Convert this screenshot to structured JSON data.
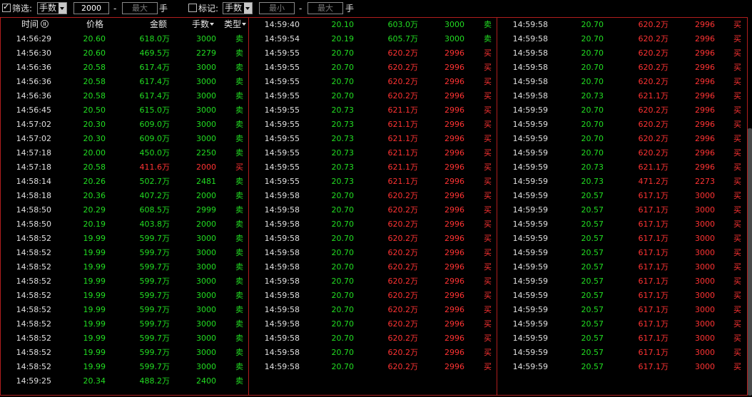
{
  "filter": {
    "checked": true,
    "label": "筛选:",
    "unit_select": "手数",
    "min_value": "2000",
    "dash": "-",
    "max_placeholder": "最大",
    "unit_suffix": "手"
  },
  "mark": {
    "checked": false,
    "label": "标记:",
    "unit_select": "手数",
    "min_placeholder": "最小",
    "dash": "-",
    "max_placeholder": "最大",
    "unit_suffix": "手"
  },
  "headers": {
    "time": "时间",
    "price": "价格",
    "amount": "金额",
    "volume": "手数",
    "type": "类型"
  },
  "colors": {
    "up": "#ff3333",
    "down": "#22dd22",
    "border": "#b01e1e"
  },
  "columns": [
    [
      [
        "14:56:29",
        "20.60",
        "618.0万",
        "3000",
        "卖"
      ],
      [
        "14:56:30",
        "20.60",
        "469.5万",
        "2279",
        "卖"
      ],
      [
        "14:56:36",
        "20.58",
        "617.4万",
        "3000",
        "卖"
      ],
      [
        "14:56:36",
        "20.58",
        "617.4万",
        "3000",
        "卖"
      ],
      [
        "14:56:36",
        "20.58",
        "617.4万",
        "3000",
        "卖"
      ],
      [
        "14:56:45",
        "20.50",
        "615.0万",
        "3000",
        "卖"
      ],
      [
        "14:57:02",
        "20.30",
        "609.0万",
        "3000",
        "卖"
      ],
      [
        "14:57:02",
        "20.30",
        "609.0万",
        "3000",
        "卖"
      ],
      [
        "14:57:18",
        "20.00",
        "450.0万",
        "2250",
        "卖"
      ],
      [
        "14:57:18",
        "20.58",
        "411.6万",
        "2000",
        "买"
      ],
      [
        "14:58:14",
        "20.26",
        "502.7万",
        "2481",
        "卖"
      ],
      [
        "14:58:18",
        "20.36",
        "407.2万",
        "2000",
        "卖"
      ],
      [
        "14:58:50",
        "20.29",
        "608.5万",
        "2999",
        "卖"
      ],
      [
        "14:58:50",
        "20.19",
        "403.8万",
        "2000",
        "卖"
      ],
      [
        "14:58:52",
        "19.99",
        "599.7万",
        "3000",
        "卖"
      ],
      [
        "14:58:52",
        "19.99",
        "599.7万",
        "3000",
        "卖"
      ],
      [
        "14:58:52",
        "19.99",
        "599.7万",
        "3000",
        "卖"
      ],
      [
        "14:58:52",
        "19.99",
        "599.7万",
        "3000",
        "卖"
      ],
      [
        "14:58:52",
        "19.99",
        "599.7万",
        "3000",
        "卖"
      ],
      [
        "14:58:52",
        "19.99",
        "599.7万",
        "3000",
        "卖"
      ],
      [
        "14:58:52",
        "19.99",
        "599.7万",
        "3000",
        "卖"
      ],
      [
        "14:58:52",
        "19.99",
        "599.7万",
        "3000",
        "卖"
      ],
      [
        "14:58:52",
        "19.99",
        "599.7万",
        "3000",
        "卖"
      ],
      [
        "14:58:52",
        "19.99",
        "599.7万",
        "3000",
        "卖"
      ],
      [
        "14:59:25",
        "20.34",
        "488.2万",
        "2400",
        "卖"
      ]
    ],
    [
      [
        "14:59:40",
        "20.10",
        "603.0万",
        "3000",
        "卖"
      ],
      [
        "14:59:54",
        "20.19",
        "605.7万",
        "3000",
        "卖"
      ],
      [
        "14:59:55",
        "20.70",
        "620.2万",
        "2996",
        "买"
      ],
      [
        "14:59:55",
        "20.70",
        "620.2万",
        "2996",
        "买"
      ],
      [
        "14:59:55",
        "20.70",
        "620.2万",
        "2996",
        "买"
      ],
      [
        "14:59:55",
        "20.70",
        "620.2万",
        "2996",
        "买"
      ],
      [
        "14:59:55",
        "20.73",
        "621.1万",
        "2996",
        "买"
      ],
      [
        "14:59:55",
        "20.73",
        "621.1万",
        "2996",
        "买"
      ],
      [
        "14:59:55",
        "20.73",
        "621.1万",
        "2996",
        "买"
      ],
      [
        "14:59:55",
        "20.73",
        "621.1万",
        "2996",
        "买"
      ],
      [
        "14:59:55",
        "20.73",
        "621.1万",
        "2996",
        "买"
      ],
      [
        "14:59:55",
        "20.73",
        "621.1万",
        "2996",
        "买"
      ],
      [
        "14:59:58",
        "20.70",
        "620.2万",
        "2996",
        "买"
      ],
      [
        "14:59:58",
        "20.70",
        "620.2万",
        "2996",
        "买"
      ],
      [
        "14:59:58",
        "20.70",
        "620.2万",
        "2996",
        "买"
      ],
      [
        "14:59:58",
        "20.70",
        "620.2万",
        "2996",
        "买"
      ],
      [
        "14:59:58",
        "20.70",
        "620.2万",
        "2996",
        "买"
      ],
      [
        "14:59:58",
        "20.70",
        "620.2万",
        "2996",
        "买"
      ],
      [
        "14:59:58",
        "20.70",
        "620.2万",
        "2996",
        "买"
      ],
      [
        "14:59:58",
        "20.70",
        "620.2万",
        "2996",
        "买"
      ],
      [
        "14:59:58",
        "20.70",
        "620.2万",
        "2996",
        "买"
      ],
      [
        "14:59:58",
        "20.70",
        "620.2万",
        "2996",
        "买"
      ],
      [
        "14:59:58",
        "20.70",
        "620.2万",
        "2996",
        "买"
      ],
      [
        "14:59:58",
        "20.70",
        "620.2万",
        "2996",
        "买"
      ],
      [
        "14:59:58",
        "20.70",
        "620.2万",
        "2996",
        "买"
      ]
    ],
    [
      [
        "14:59:58",
        "20.70",
        "620.2万",
        "2996",
        "买"
      ],
      [
        "14:59:58",
        "20.70",
        "620.2万",
        "2996",
        "买"
      ],
      [
        "14:59:58",
        "20.70",
        "620.2万",
        "2996",
        "买"
      ],
      [
        "14:59:58",
        "20.70",
        "620.2万",
        "2996",
        "买"
      ],
      [
        "14:59:58",
        "20.70",
        "620.2万",
        "2996",
        "买"
      ],
      [
        "14:59:58",
        "20.73",
        "621.1万",
        "2996",
        "买"
      ],
      [
        "14:59:59",
        "20.70",
        "620.2万",
        "2996",
        "买"
      ],
      [
        "14:59:59",
        "20.70",
        "620.2万",
        "2996",
        "买"
      ],
      [
        "14:59:59",
        "20.70",
        "620.2万",
        "2996",
        "买"
      ],
      [
        "14:59:59",
        "20.70",
        "620.2万",
        "2996",
        "买"
      ],
      [
        "14:59:59",
        "20.73",
        "621.1万",
        "2996",
        "买"
      ],
      [
        "14:59:59",
        "20.73",
        "471.2万",
        "2273",
        "买"
      ],
      [
        "14:59:59",
        "20.57",
        "617.1万",
        "3000",
        "买"
      ],
      [
        "14:59:59",
        "20.57",
        "617.1万",
        "3000",
        "买"
      ],
      [
        "14:59:59",
        "20.57",
        "617.1万",
        "3000",
        "买"
      ],
      [
        "14:59:59",
        "20.57",
        "617.1万",
        "3000",
        "买"
      ],
      [
        "14:59:59",
        "20.57",
        "617.1万",
        "3000",
        "买"
      ],
      [
        "14:59:59",
        "20.57",
        "617.1万",
        "3000",
        "买"
      ],
      [
        "14:59:59",
        "20.57",
        "617.1万",
        "3000",
        "买"
      ],
      [
        "14:59:59",
        "20.57",
        "617.1万",
        "3000",
        "买"
      ],
      [
        "14:59:59",
        "20.57",
        "617.1万",
        "3000",
        "买"
      ],
      [
        "14:59:59",
        "20.57",
        "617.1万",
        "3000",
        "买"
      ],
      [
        "14:59:59",
        "20.57",
        "617.1万",
        "3000",
        "买"
      ],
      [
        "14:59:59",
        "20.57",
        "617.1万",
        "3000",
        "买"
      ],
      [
        "14:59:59",
        "20.57",
        "617.1万",
        "3000",
        "买"
      ]
    ]
  ]
}
